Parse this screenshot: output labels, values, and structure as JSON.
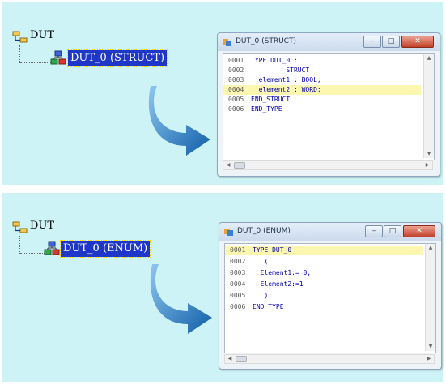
{
  "panels": [
    {
      "tree": {
        "root_label": "DUT",
        "child_label": "DUT_0 (STRUCT)"
      },
      "window": {
        "title": "DUT_0 (STRUCT)",
        "lines": [
          {
            "num": "0001",
            "code": "TYPE DUT_0 :",
            "highlight": false
          },
          {
            "num": "0002",
            "code": "         STRUCT",
            "highlight": false
          },
          {
            "num": "0003",
            "code": "  element1 : BOOL;",
            "highlight": false
          },
          {
            "num": "0004",
            "code": "  element2 : WORD;",
            "highlight": true
          },
          {
            "num": "0005",
            "code": "END_STRUCT",
            "highlight": false
          },
          {
            "num": "0006",
            "code": "END_TYPE",
            "highlight": false
          }
        ]
      }
    },
    {
      "tree": {
        "root_label": "DUT",
        "child_label": "DUT_0 (ENUM)"
      },
      "window": {
        "title": "DUT_0 (ENUM)",
        "lines": [
          {
            "num": "0001",
            "code": "TYPE DUT_0",
            "highlight": true
          },
          {
            "num": "0002",
            "code": "   (",
            "highlight": false
          },
          {
            "num": "0003",
            "code": "  Element1:= 0,",
            "highlight": false
          },
          {
            "num": "0004",
            "code": "  Element2:=1",
            "highlight": false
          },
          {
            "num": "0005",
            "code": "   );",
            "highlight": false
          },
          {
            "num": "0006",
            "code": "END_TYPE",
            "highlight": false
          }
        ]
      }
    }
  ],
  "colors": {
    "panel_background": "#cdf3f6",
    "selection": "#1e37c8",
    "arrow": "#1a6fb5",
    "code": "#0000aa",
    "line_highlight": "#fbf6b0"
  }
}
